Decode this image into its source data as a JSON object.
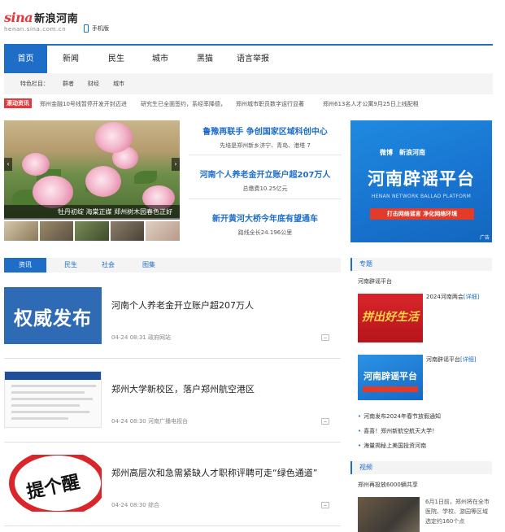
{
  "header": {
    "logo_brand": "sina",
    "logo_name": "新浪河南",
    "logo_domain": "henan.sina.com.cn",
    "mobile_label": "手机版"
  },
  "nav": {
    "items": [
      "首页",
      "新闻",
      "民生",
      "城市",
      "黑猫",
      "语言举报"
    ],
    "active_index": 0
  },
  "subnav": {
    "label": "特色栏目：",
    "items": [
      "群者",
      "财经",
      "城市"
    ]
  },
  "ticker": {
    "label": "滚动资讯",
    "items": [
      "郑州金融10号线暂停开发开封迈进",
      "研究生已全面签约，系经率降德，",
      "郑州城市职员数字运行显著",
      "郑州613名人才公寓9月25日上线配租"
    ]
  },
  "slideshow": {
    "caption": "牡丹初绽 海棠正媒 郑州树木园春色正好",
    "prev_icon": "chevron-left-icon",
    "next_icon": "chevron-right-icon"
  },
  "headlines": [
    {
      "title": "鲁豫再联手 争创国家区域科创中心",
      "sub": "先培是郑州新乡济宁、青岛、港塔 7"
    },
    {
      "title": "河南个人养老金开立账户超207万人",
      "sub": "总缴费10.25亿元"
    },
    {
      "title": "新开黄河大桥今年底有望通车",
      "sub": "路线全长24.196公里"
    }
  ],
  "ad": {
    "weibo": "微博",
    "sina": "新浪河南",
    "title": "河南辟谣平台",
    "subtitle_en": "HENAN NETWORK BALLAD PLATFORM",
    "bar": "打击网络谣言 净化网络环境",
    "corner": "广告"
  },
  "tabs": {
    "items": [
      "资讯",
      "民生",
      "社会",
      "图集"
    ],
    "active_index": 0
  },
  "news": [
    {
      "title": "河南个人养老金开立账户超207万人",
      "date": "04-24 08:31",
      "source": "政府网站",
      "thumb_text": "权威发布"
    },
    {
      "title": "郑州大学新校区，落户郑州航空港区",
      "date": "04-24 08:30",
      "source": "河南广播电视台",
      "thumb_text": ""
    },
    {
      "title": "郑州高层次和急需紧缺人才职称评聘可走“绿色通道”",
      "date": "04-24 08:30",
      "source": "综合",
      "thumb_text": "提个醒"
    }
  ],
  "sidebar": {
    "topic_head": "专题",
    "topic_sub": "河南辟谣平台",
    "promo1_text": "拼出好生活",
    "promo1_caption": "2024河南两会",
    "promo1_link": "[详细]",
    "promo2_text": "河南辟谣平台",
    "promo2_caption": "河南辟谣平台",
    "promo2_link": "[详细]",
    "bullets": [
      "河南发布2024年春节放假通知",
      "喜喜！郑州新航空航天大学！",
      "海量揭秘上美国投资河南"
    ],
    "video_head": "视频",
    "video_sub": "郑州再投放6000辆共享",
    "video_desc": "6月1日前，郑州将在全市医院、学校、游园等区域选定约160个点"
  },
  "colors": {
    "brand_blue": "#1e6ec8",
    "sina_red": "#e4393c"
  }
}
